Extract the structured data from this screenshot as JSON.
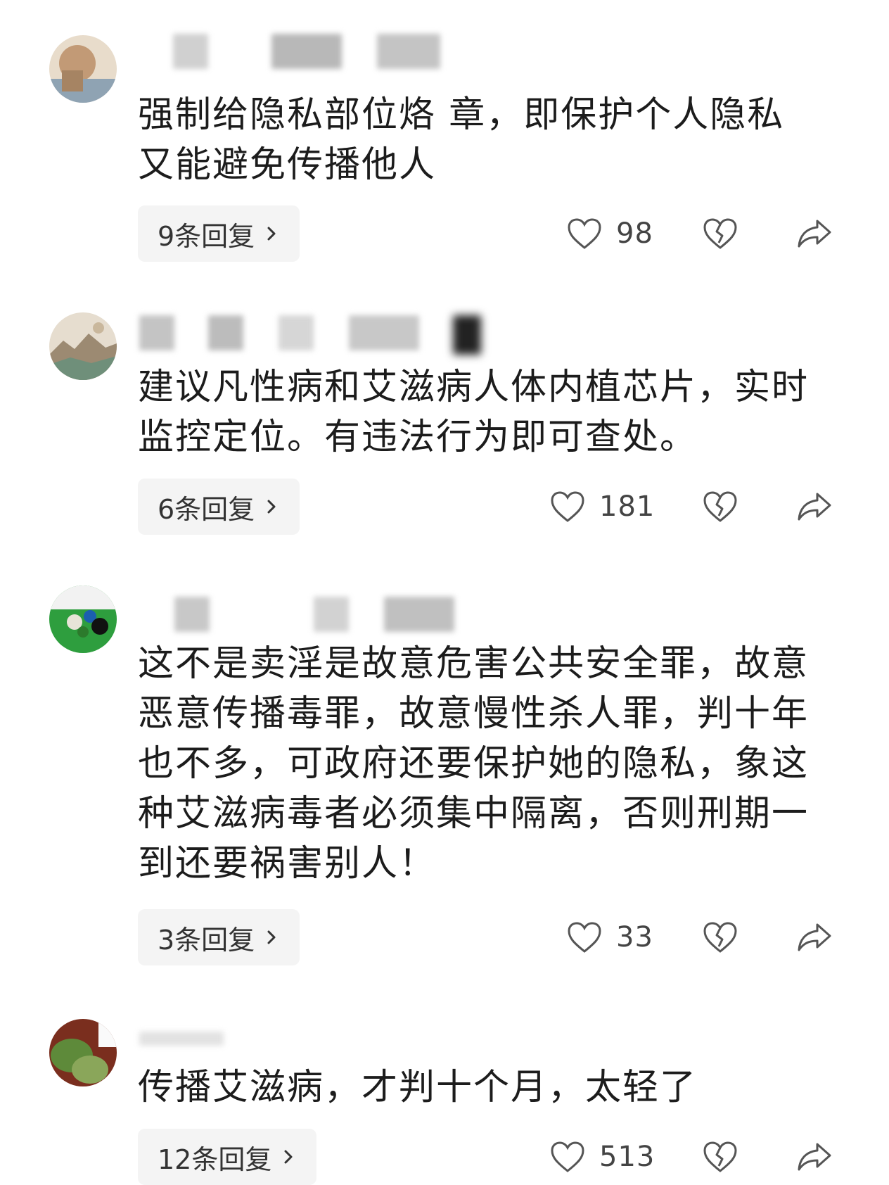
{
  "comments": [
    {
      "text": "强制给隐私部位烙 章，即保护个人隐私又能避免传播他人",
      "reply_label": "9条回复",
      "likes": "98",
      "avatar": "avatar-photo",
      "avatar_colors": [
        "#c9a98a",
        "#6e8aa3"
      ]
    },
    {
      "text": "建议凡性病和艾滋病人体内植芯片，实时监控定位。有违法行为即可查处。",
      "reply_label": "6条回复",
      "likes": "181",
      "avatar": "avatar-landscape-painting",
      "avatar_colors": [
        "#b5a48c",
        "#6f8f7a"
      ]
    },
    {
      "text": "这不是卖淫是故意危害公共安全罪，故意恶意传播毒罪，故意慢性杀人罪，判十年也不多，可政府还要保护她的隐私，象这种艾滋病毒者必须集中隔离，否则刑期一到还要祸害别人！",
      "reply_label": "3条回复",
      "likes": "33",
      "avatar": "avatar-billiards",
      "avatar_colors": [
        "#2e9e3e",
        "#111111"
      ]
    },
    {
      "text": "传播艾滋病，才判十个月，太轻了",
      "reply_label": "12条回复",
      "likes": "513",
      "avatar": "avatar-melons",
      "avatar_colors": [
        "#5e8a3a",
        "#7a2e1e"
      ]
    }
  ],
  "icons": {
    "like": "heart-outline-icon",
    "dislike": "broken-heart-icon",
    "share": "share-arrow-icon",
    "chevron": "chevron-right-icon"
  }
}
